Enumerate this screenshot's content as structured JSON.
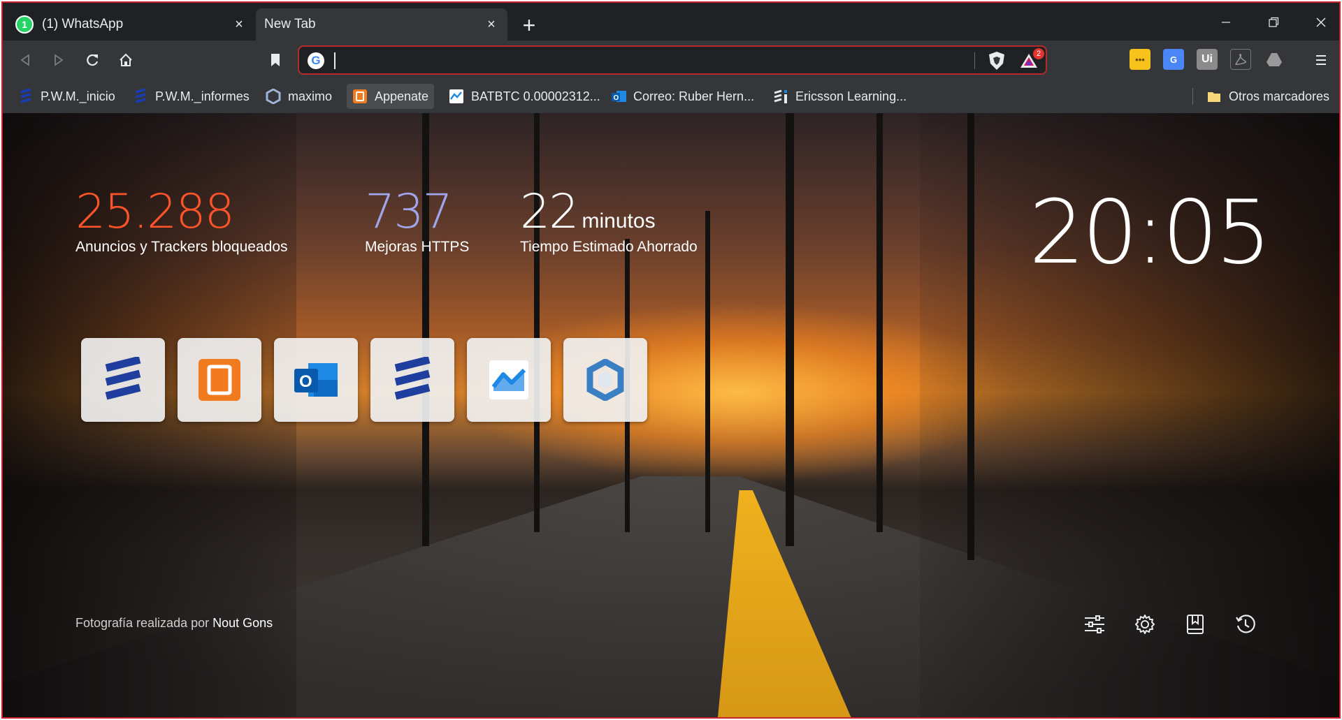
{
  "tabs": [
    {
      "title": "(1) WhatsApp",
      "favicon_badge": "1",
      "close": "×"
    },
    {
      "title": "New Tab",
      "close": "×"
    }
  ],
  "new_tab_symbol": "+",
  "omnibox": {
    "value": "",
    "placeholder": "",
    "rewards_badge": "2"
  },
  "extensions": [
    {
      "name": "extension-yellow",
      "label": "•••",
      "color": "#f6c21b"
    },
    {
      "name": "google-translate",
      "label": "G",
      "color": "#4a86f5"
    },
    {
      "name": "uipath",
      "label": "Ui",
      "color": "#8a8a8a"
    },
    {
      "name": "pdf",
      "label": "",
      "color": "#555"
    },
    {
      "name": "google-drive",
      "label": "",
      "color": "#6e6e6e"
    }
  ],
  "bookmarks": [
    {
      "label": "P.W.M._inicio",
      "icon": "ericsson-icon"
    },
    {
      "label": "P.W.M._informes",
      "icon": "ericsson-icon"
    },
    {
      "label": "maximo",
      "icon": "maximo-icon"
    },
    {
      "label": "Appenate",
      "icon": "appenate-icon"
    },
    {
      "label": "BATBTC 0.00002312...",
      "icon": "chart-icon"
    },
    {
      "label": "Correo: Ruber Hern...",
      "icon": "outlook-icon"
    },
    {
      "label": "Ericsson Learning...",
      "icon": "ericsson-learning-icon"
    }
  ],
  "other_bookmarks": "Otros marcadores",
  "stats": {
    "ads": {
      "value": "25.288",
      "label": "Anuncios y Trackers bloqueados"
    },
    "https": {
      "value": "737",
      "label": "Mejoras HTTPS"
    },
    "time": {
      "value": "22",
      "unit": "minutos",
      "label": "Tiempo Estimado Ahorrado"
    }
  },
  "clock": "20:05",
  "top_sites": [
    {
      "name": "ericsson",
      "icon": "ericsson-icon"
    },
    {
      "name": "appenate",
      "icon": "appenate-icon"
    },
    {
      "name": "outlook",
      "icon": "outlook-icon"
    },
    {
      "name": "ericsson-2",
      "icon": "ericsson-icon"
    },
    {
      "name": "chart",
      "icon": "chart-icon"
    },
    {
      "name": "maximo",
      "icon": "maximo-icon"
    }
  ],
  "credit": {
    "prefix": "Fotografía realizada por ",
    "author": "Nout Gons"
  },
  "colors": {
    "ads": "#fb542b",
    "https": "#a0a5eb",
    "frame": "#c8232c"
  }
}
